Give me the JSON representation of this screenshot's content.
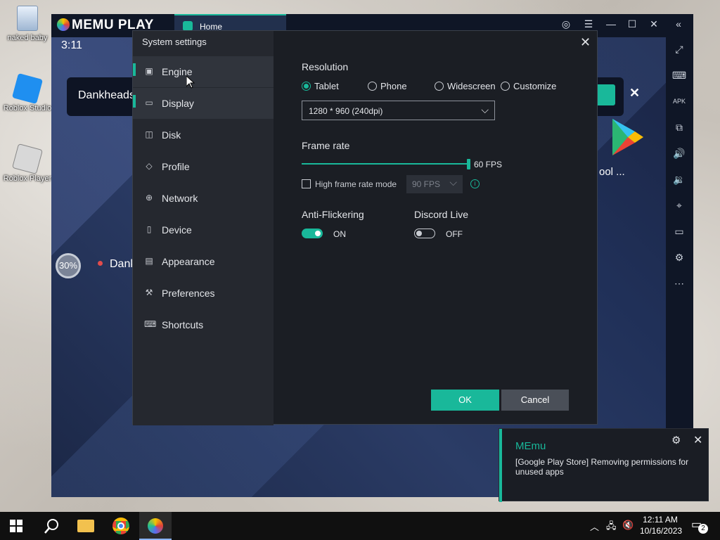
{
  "desktop": {
    "icons": [
      {
        "label": "naked baby",
        "icon": "recycle-bin-icon"
      },
      {
        "label": "Roblox Studio",
        "icon": "roblox-studio-icon"
      },
      {
        "label": "Roblox Player",
        "icon": "roblox-player-icon"
      }
    ]
  },
  "emulator": {
    "logo": "MEMU PLAY",
    "tab_label": "Home",
    "android_time": "3:11",
    "search_text": "Dankheads",
    "app_label": "ool ...",
    "progress_text": "30%",
    "recent_app": "Dank"
  },
  "dialog": {
    "title": "System settings",
    "nav": [
      {
        "label": "Engine",
        "icon": "chip-icon",
        "active": true
      },
      {
        "label": "Display",
        "icon": "monitor-icon",
        "active": false
      },
      {
        "label": "Disk",
        "icon": "disk-icon",
        "active": false
      },
      {
        "label": "Profile",
        "icon": "tag-icon",
        "active": false
      },
      {
        "label": "Network",
        "icon": "globe-icon",
        "active": false
      },
      {
        "label": "Device",
        "icon": "phone-icon",
        "active": false
      },
      {
        "label": "Appearance",
        "icon": "window-icon",
        "active": false
      },
      {
        "label": "Preferences",
        "icon": "wrench-icon",
        "active": false
      },
      {
        "label": "Shortcuts",
        "icon": "keyboard-icon",
        "active": false
      }
    ],
    "resolution": {
      "label": "Resolution",
      "options": [
        "Tablet",
        "Phone",
        "Widescreen",
        "Customize"
      ],
      "selected": "Tablet",
      "value": "1280 * 960 (240dpi)"
    },
    "frame_rate": {
      "label": "Frame rate",
      "value_text": "60 FPS",
      "slider_fraction": 1.0,
      "high_mode_label": "High frame rate mode",
      "high_mode_checked": false,
      "high_mode_value": "90 FPS"
    },
    "anti_flickering": {
      "label": "Anti-Flickering",
      "state": "ON"
    },
    "discord_live": {
      "label": "Discord Live",
      "state": "OFF"
    },
    "ok_label": "OK",
    "cancel_label": "Cancel"
  },
  "toast": {
    "title": "MEmu",
    "message": "[Google Play Store] Removing permissions for unused apps"
  },
  "taskbar": {
    "time": "12:11 AM",
    "date": "10/16/2023",
    "notification_count": "2"
  },
  "colors": {
    "accent": "#19b89a",
    "dialog_bg": "#1b1e24",
    "sidebar_bg": "#25282f",
    "taskbar": "#101010"
  }
}
